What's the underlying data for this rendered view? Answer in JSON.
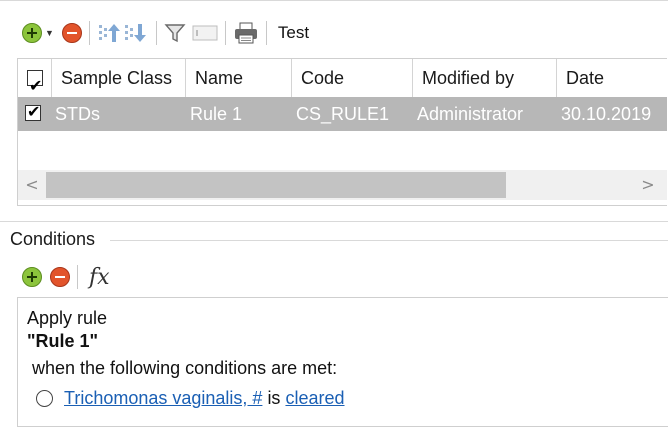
{
  "toolbar": {
    "test_label": "Test"
  },
  "grid": {
    "header_checkbox": "☑",
    "columns": [
      "Sample Class",
      "Name",
      "Code",
      "Modified by",
      "Date"
    ],
    "rows": [
      {
        "checked": true,
        "cells": [
          "STDs",
          "Rule 1",
          "CS_RULE1",
          "Administrator",
          "30.10.2019"
        ]
      }
    ],
    "scroll_left": "<",
    "scroll_right": ">"
  },
  "conditions": {
    "title": "Conditions",
    "fx_label": "fx",
    "line1": "Apply rule",
    "rule_name": "\"Rule 1\"",
    "line3": "when the following conditions are met:",
    "condition_link": "Trichomonas vaginalis, #",
    "condition_op": "is",
    "condition_value": "cleared"
  },
  "colors": {
    "selected_row": "#b7b7b7",
    "add_icon": "#8cc43c",
    "remove_icon": "#e2542b",
    "link": "#1a5fb4"
  }
}
